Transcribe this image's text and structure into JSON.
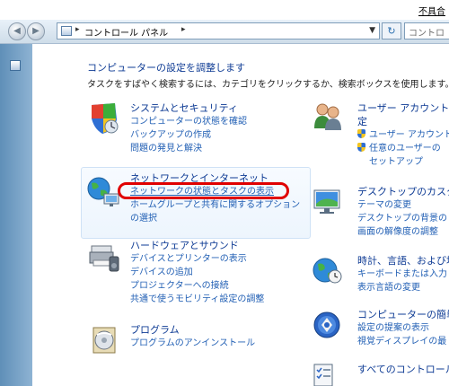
{
  "top_link": "不具合",
  "address": {
    "crumb": "コントロール パネル",
    "search_placeholder": "コントロ"
  },
  "main": {
    "heading": "コンピューターの設定を調整します",
    "description": "タスクをすばやく検索するには、カテゴリをクリックするか、検索ボックスを使用します。",
    "left_categories": [
      {
        "title": "システムとセキュリティ",
        "links": [
          "コンピューターの状態を確認",
          "バックアップの作成",
          "問題の発見と解決"
        ]
      },
      {
        "title": "ネットワークとインターネット",
        "links": [
          "ネットワークの状態とタスクの表示",
          "ホームグループと共有に関するオプション",
          "の選択"
        ]
      },
      {
        "title": "ハードウェアとサウンド",
        "links": [
          "デバイスとプリンターの表示",
          "デバイスの追加",
          "プロジェクターへの接続",
          "共通で使うモビリティ設定の調整"
        ]
      },
      {
        "title": "プログラム",
        "links": [
          "プログラムのアンインストール"
        ]
      }
    ],
    "right_categories": [
      {
        "title": "ユーザー アカウント",
        "title_cont": "定",
        "links": [
          "ユーザー アカウント",
          "任意のユーザーの",
          "セットアップ"
        ]
      },
      {
        "title": "デスクトップのカスタ",
        "links": [
          "テーマの変更",
          "デスクトップの背景の",
          "画面の解像度の調整"
        ]
      },
      {
        "title": "時計、言語、および地域",
        "links": [
          "キーボードまたは入力",
          "表示言語の変更"
        ]
      },
      {
        "title": "コンピューターの簡単操",
        "links": [
          "設定の提案の表示",
          "視覚ディスプレイの最"
        ]
      },
      {
        "title": "すべてのコントロール",
        "links": []
      }
    ]
  }
}
